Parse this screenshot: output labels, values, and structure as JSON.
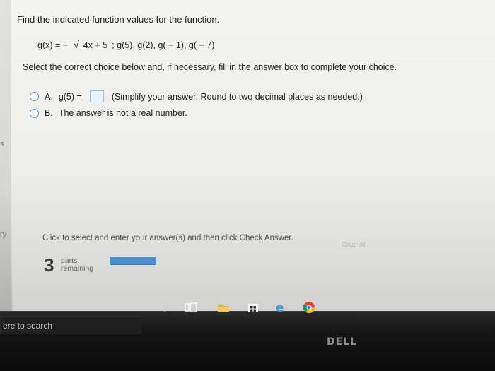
{
  "question": {
    "title": "Find the indicated function values for the function.",
    "function_prefix": "g(x) = −",
    "radicand": "4x + 5",
    "requested_values": "; g(5), g(2), g( − 1), g( − 7)"
  },
  "instruction": "Select the correct choice below and, if necessary, fill in the answer box to complete your choice.",
  "choices": [
    {
      "letter": "A.",
      "text_before": "g(5) =",
      "text_after": "(Simplify your answer. Round to two decimal places as needed.)",
      "answer_value": ""
    },
    {
      "letter": "B.",
      "text": "The answer is not a real number."
    }
  ],
  "footer": {
    "help_text": "Click to select and enter your answer(s) and then click Check Answer.",
    "clear_all": "Clear All",
    "parts_count": "3",
    "parts_label": "parts",
    "remaining_label": "remaining"
  },
  "left_strip": {
    "s_label": "s",
    "ry_label": "ry"
  },
  "taskbar": {
    "search_placeholder": "ere to search"
  },
  "monitor": {
    "brand": "DELL"
  },
  "colors": {
    "accent_blue": "#4a8ed0",
    "radio_border": "#5a8fc3",
    "taskbar": "#121212"
  },
  "icons": {
    "microphone": "mic-icon",
    "task_view": "taskview-icon",
    "file_explorer": "folder-icon",
    "store": "store-icon",
    "edge": "edge-icon",
    "chrome": "chrome-icon"
  }
}
